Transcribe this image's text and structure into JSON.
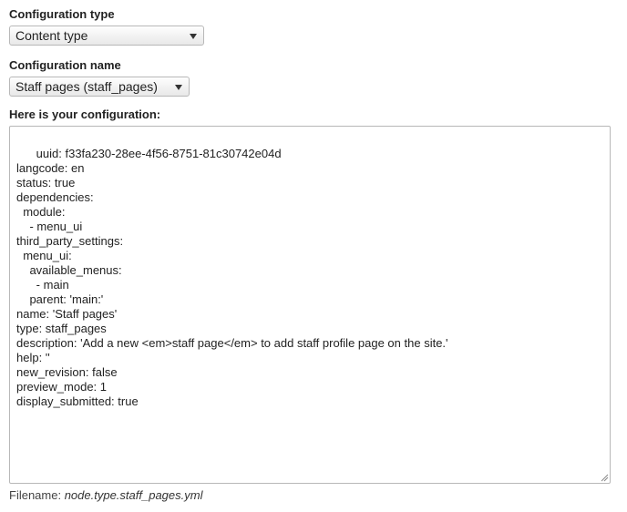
{
  "config_type": {
    "label": "Configuration type",
    "selected": "Content type"
  },
  "config_name": {
    "label": "Configuration name",
    "selected": "Staff pages (staff_pages)"
  },
  "config_output": {
    "label": "Here is your configuration:",
    "content": "uuid: f33fa230-28ee-4f56-8751-81c30742e04d\nlangcode: en\nstatus: true\ndependencies:\n  module:\n    - menu_ui\nthird_party_settings:\n  menu_ui:\n    available_menus:\n      - main\n    parent: 'main:'\nname: 'Staff pages'\ntype: staff_pages\ndescription: 'Add a new <em>staff page</em> to add staff profile page on the site.'\nhelp: ''\nnew_revision: false\npreview_mode: 1\ndisplay_submitted: true"
  },
  "filename": {
    "label": "Filename:",
    "value": "node.type.staff_pages.yml"
  },
  "icons": {
    "dropdown": "chevron-down-icon",
    "resize": "resize-handle-icon"
  }
}
